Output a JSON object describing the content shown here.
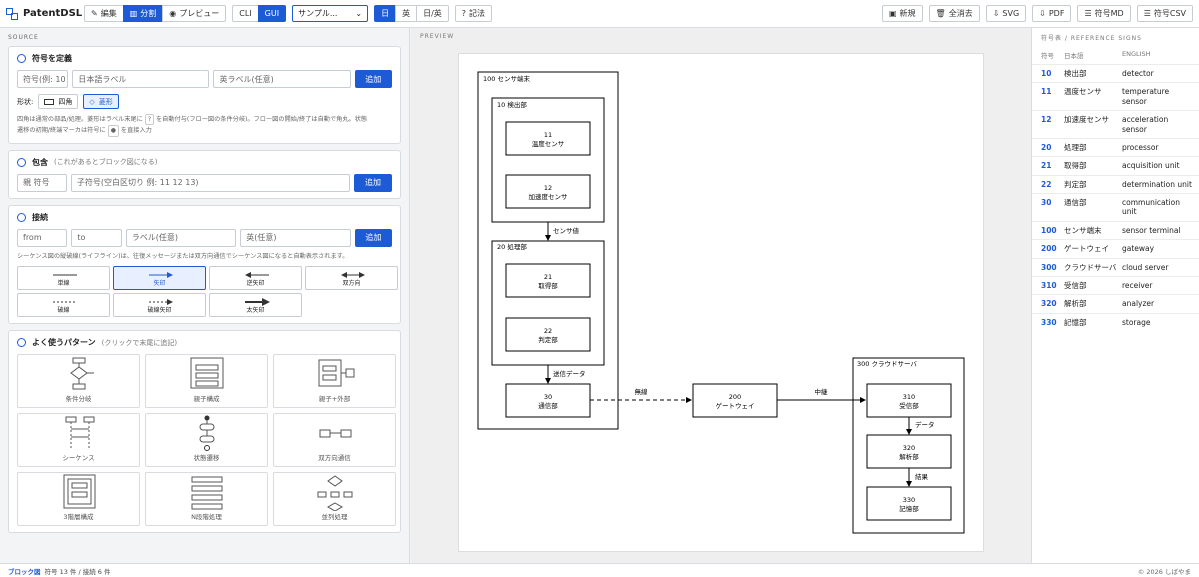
{
  "app": {
    "title": "PatentDSL"
  },
  "toolbar": {
    "edit": "編集",
    "split": "分割",
    "preview": "プレビュー",
    "cli": "CLI",
    "gui": "GUI",
    "sample": "サンプル...",
    "lang_ja": "日",
    "lang_en": "英",
    "lang_both": "日/英",
    "notation": "記法",
    "new": "新規",
    "clear": "全消去",
    "svg": "SVG",
    "pdf": "PDF",
    "symbol_md": "符号MD",
    "symbol_csv": "符号CSV"
  },
  "source": {
    "section": "SOURCE",
    "define": {
      "title": "符号を定義",
      "num_placeholder": "符号(例: 10",
      "ja_placeholder": "日本語ラベル",
      "en_placeholder": "英ラベル(任意)",
      "add": "追加",
      "shape_label": "形状:",
      "shape_rect": "四角",
      "shape_diamond": "菱形",
      "help1": "四角は通常の部品/処理。菱形はラベル末尾に",
      "help_key": "?",
      "help2": "を自動付与(フロー図の条件分岐)。フロー図の開始/終了は自動で角丸。状態",
      "help3": "遷移の初期/終端マーカは符号に",
      "help_key2": "●",
      "help4": "を直接入力"
    },
    "contain": {
      "title": "包含",
      "subtitle": "(これがあるとブロック図になる)",
      "parent": "親 符号",
      "children": "子符号(空白区切り 例: 11 12 13)",
      "add": "追加"
    },
    "connect": {
      "title": "接続",
      "from": "from",
      "to": "to",
      "label": "ラベル(任意)",
      "en": "英(任意)",
      "add": "追加",
      "help": "シーケンス図の縦破線(ライフライン)は、往復メッセージまたは双方向通信でシーケンス図になると自動表示されます。",
      "arrows": [
        "単線",
        "矢印",
        "逆矢印",
        "双方向",
        "破線",
        "破線矢印",
        "太矢印"
      ]
    },
    "patterns": {
      "title": "よく使うパターン",
      "subtitle": "(クリックで末尾に追記)",
      "items": [
        "条件分岐",
        "親子構成",
        "親子+外部",
        "シーケンス",
        "状態遷移",
        "双方向通信",
        "3階層構成",
        "N段階処理",
        "並列処理"
      ]
    }
  },
  "preview": {
    "section": "PREVIEW",
    "diagram": {
      "b100": "100 センサ端末",
      "b10": "10 検出部",
      "b11n": "11",
      "b11t": "温度センサ",
      "b12n": "12",
      "b12t": "加速度センサ",
      "e_sensor": "センサ値",
      "b20": "20 処理部",
      "b21n": "21",
      "b21t": "取得部",
      "b22n": "22",
      "b22t": "判定部",
      "e_send": "送信データ",
      "b30n": "30",
      "b30t": "通信部",
      "e_wireless": "無線",
      "b200n": "200",
      "b200t": "ゲートウェイ",
      "e_relay": "中継",
      "b300": "300 クラウドサーバ",
      "b310n": "310",
      "b310t": "受信部",
      "e_data": "データ",
      "b320n": "320",
      "b320t": "解析部",
      "e_result": "結果",
      "b330n": "330",
      "b330t": "記憶部"
    }
  },
  "reference": {
    "section": "符号表 / REFERENCE SIGNS",
    "headers": [
      "符号",
      "日本語",
      "ENGLISH"
    ],
    "rows": [
      [
        "10",
        "検出部",
        "detector"
      ],
      [
        "11",
        "温度センサ",
        "temperature sensor"
      ],
      [
        "12",
        "加速度センサ",
        "acceleration sensor"
      ],
      [
        "20",
        "処理部",
        "processor"
      ],
      [
        "21",
        "取得部",
        "acquisition unit"
      ],
      [
        "22",
        "判定部",
        "determination unit"
      ],
      [
        "30",
        "通信部",
        "communication unit"
      ],
      [
        "100",
        "センサ端末",
        "sensor terminal"
      ],
      [
        "200",
        "ゲートウェイ",
        "gateway"
      ],
      [
        "300",
        "クラウドサーバ",
        "cloud server"
      ],
      [
        "310",
        "受信部",
        "receiver"
      ],
      [
        "320",
        "解析部",
        "analyzer"
      ],
      [
        "330",
        "記憶部",
        "storage"
      ]
    ]
  },
  "footer": {
    "mode": "ブロック図",
    "stats": "符号 13 件 / 接続 6 件",
    "copyright": "© 2026 しばやま"
  },
  "colors": {
    "accent": "#1d5bd6",
    "border": "#d8dbe0"
  }
}
